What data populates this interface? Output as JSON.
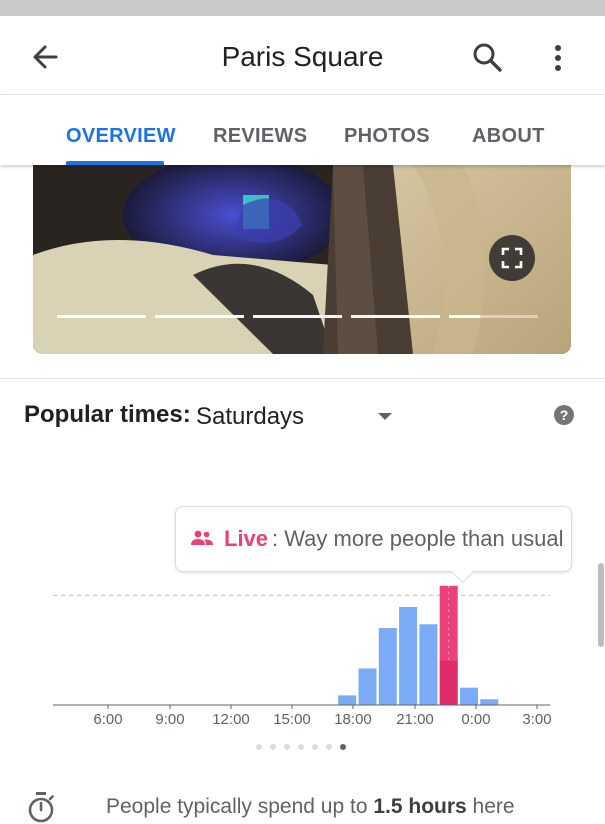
{
  "header": {
    "title": "Paris Square"
  },
  "tabs": [
    {
      "label": "OVERVIEW",
      "active": true
    },
    {
      "label": "REVIEWS",
      "active": false
    },
    {
      "label": "PHOTOS",
      "active": false
    },
    {
      "label": "ABOUT",
      "active": false
    }
  ],
  "photo_carousel": {
    "photo_count": 5,
    "current_photo": 5,
    "current_progress": 0.35
  },
  "popular_times": {
    "label": "Popular times:",
    "day": "Saturdays",
    "live": {
      "label": "Live",
      "rest": ": Way more people than usual"
    }
  },
  "chart_data": {
    "type": "bar",
    "x_tick_labels": [
      "6:00",
      "9:00",
      "12:00",
      "15:00",
      "18:00",
      "21:00",
      "0:00",
      "3:00"
    ],
    "series": [
      {
        "values": [
          0,
          0,
          0,
          0,
          0,
          0,
          0,
          0,
          0,
          0,
          0,
          0,
          0,
          0,
          5,
          19,
          40,
          51,
          42,
          0,
          9,
          3,
          0
        ]
      }
    ],
    "live": {
      "hour": 19,
      "value": 62,
      "usual": 23
    },
    "dashed_line_value": 57,
    "colors": {
      "bar": "#7baaf7",
      "live": "#ec407a",
      "live_dark": "#d81b60"
    }
  },
  "pager": {
    "dots": 7,
    "active": 6
  },
  "visit_duration": {
    "prefix": "People typically spend up to ",
    "bold": "1.5 hours",
    "suffix": " here"
  },
  "icons": [
    "back-arrow-icon",
    "search-icon",
    "more-vert-icon",
    "fullscreen-icon",
    "dropdown-arrow-icon",
    "help-icon",
    "people-icon",
    "timer-icon"
  ]
}
